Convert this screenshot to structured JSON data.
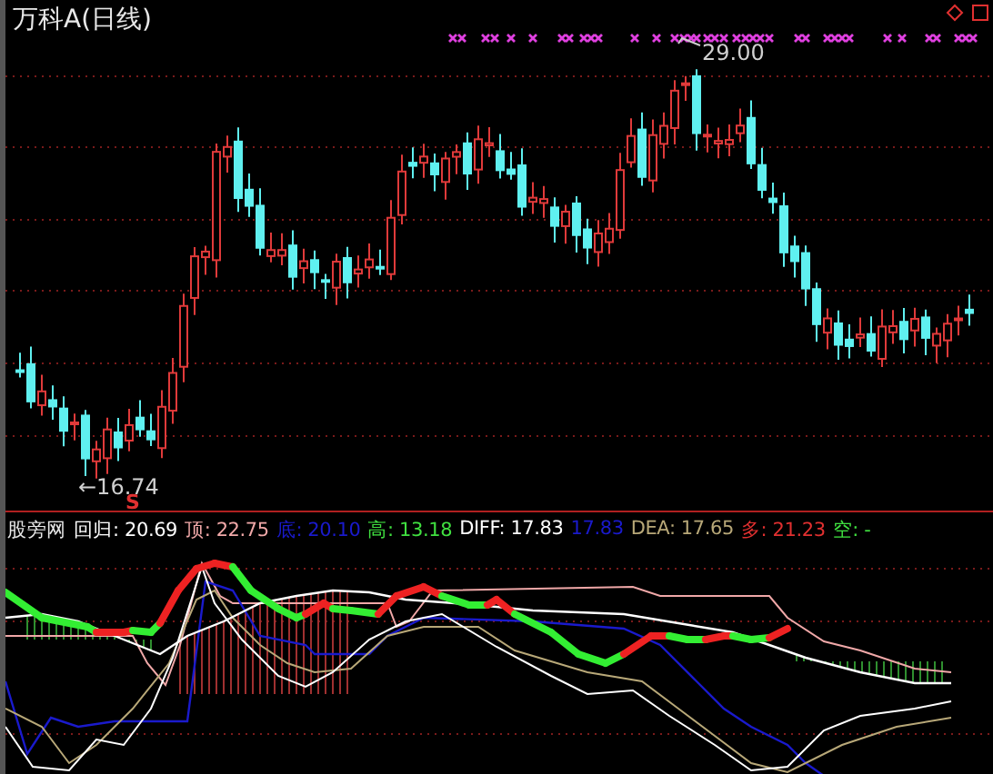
{
  "chart_title": "万科A(日线)",
  "price_labels": {
    "high": "29.00",
    "low": "←16.74",
    "signal": "S"
  },
  "indicator": {
    "name": "股旁网",
    "values": [
      {
        "text": "回归: 20.69",
        "color": "#ffffff"
      },
      {
        "text": "顶: 22.75",
        "color": "#f0a8a8"
      },
      {
        "text": "底: 20.10",
        "color": "#1a1acc"
      },
      {
        "text": "高: 13.18",
        "color": "#40e040"
      },
      {
        "text": "DIFF: 17.83",
        "color": "#ffffff"
      },
      {
        "text": "17.83",
        "color": "#1a1acc"
      },
      {
        "text": "DEA: 17.65",
        "color": "#b8a878"
      },
      {
        "text": "多: 21.23",
        "color": "#e03030"
      },
      {
        "text": "空: -",
        "color": "#40e040"
      }
    ]
  }
}
